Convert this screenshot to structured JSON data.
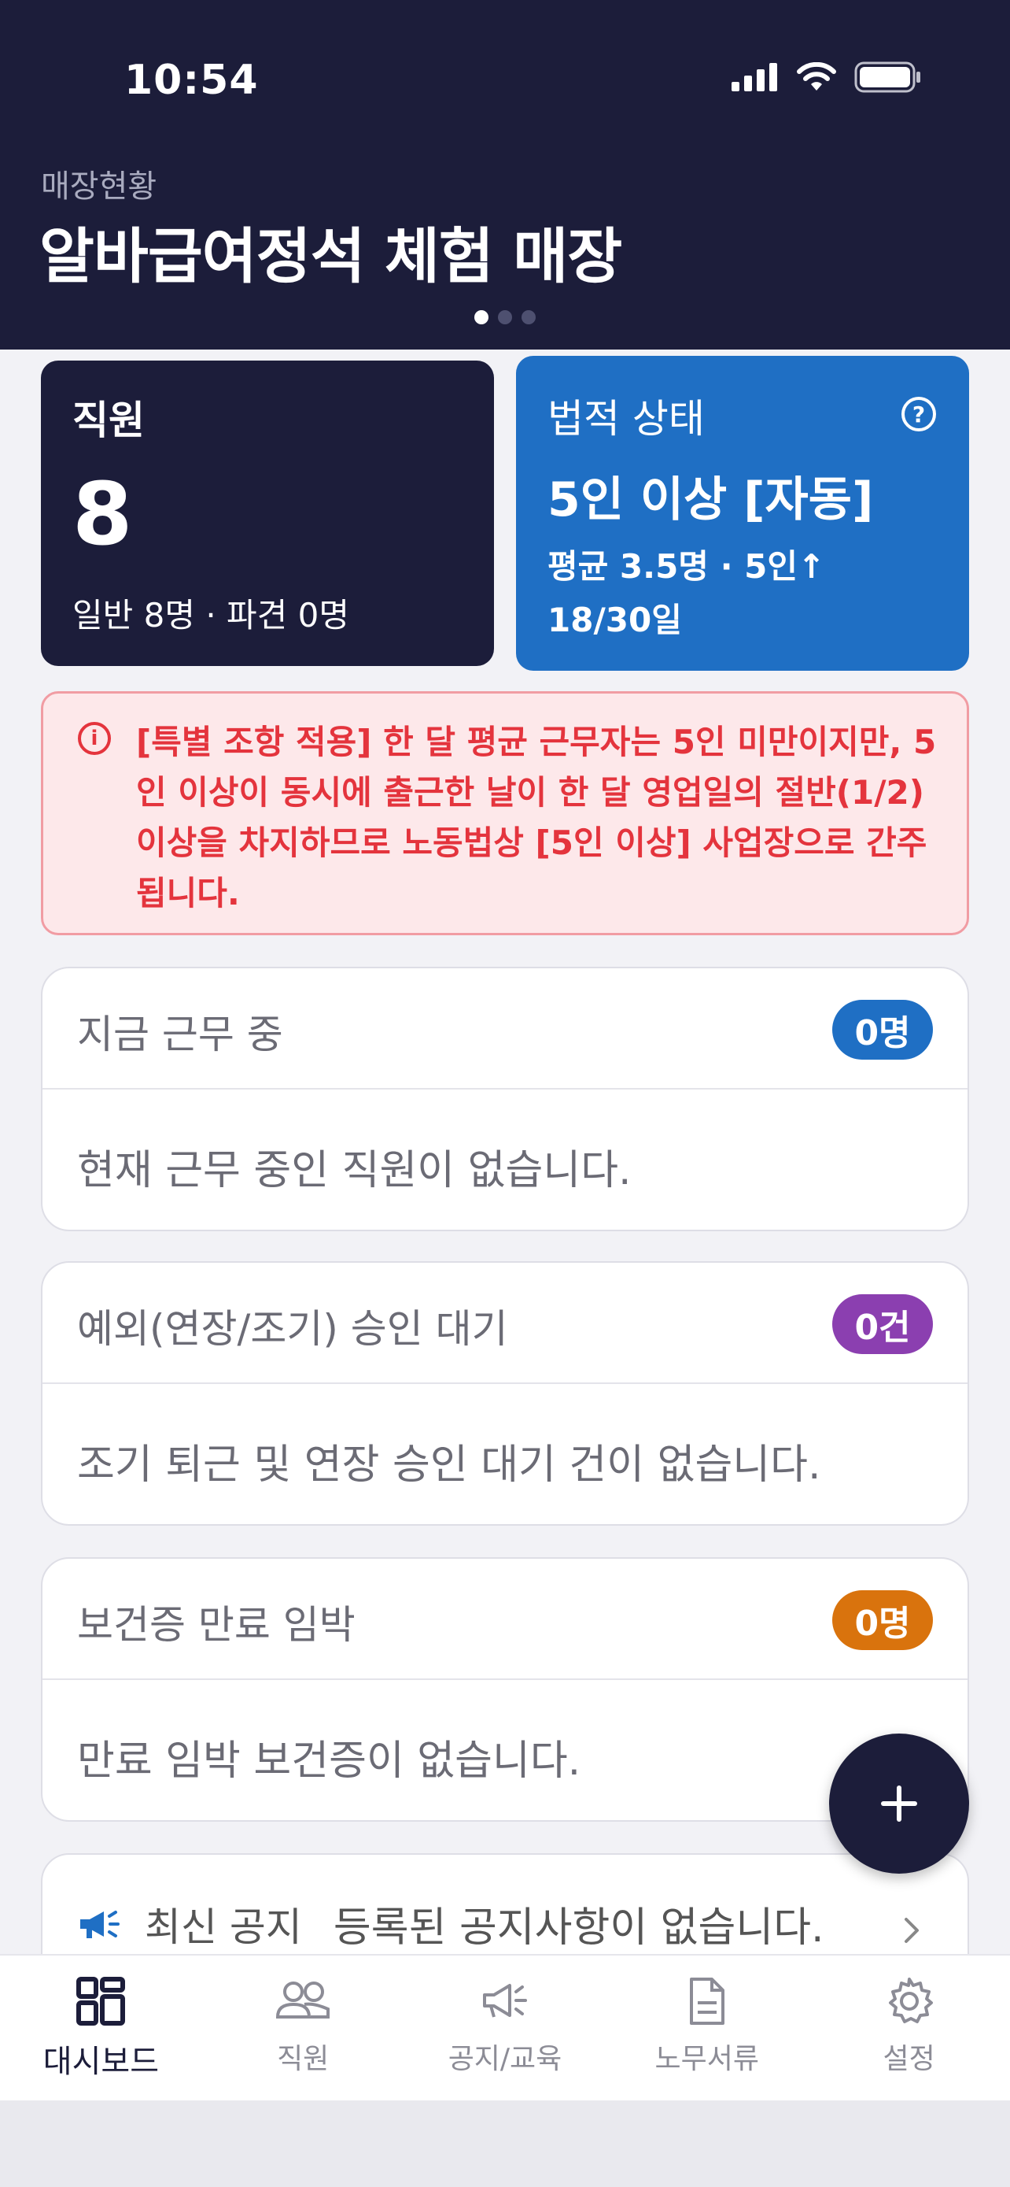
{
  "status_bar": {
    "time": "10:54"
  },
  "header": {
    "subtitle": "매장현황",
    "store_name": "알바급여정석 체험 매장"
  },
  "staff_card": {
    "label": "직원",
    "count": "8",
    "detail": "일반 8명 · 파견 0명"
  },
  "legal_card": {
    "label": "법적 상태",
    "status": "5인 이상 [자동]",
    "average": "평균 3.5명 · 5인↑",
    "days": "18/30일"
  },
  "warning": {
    "text": "[특별 조항 적용] 한 달 평균 근무자는 5인 미만이지만, 5인 이상이 동시에 출근한 날이 한 달 영업일의 절반(1/2) 이상을 차지하므로 노동법상 [5인 이상] 사업장으로 간주됩니다."
  },
  "sections": {
    "working": {
      "title": "지금 근무 중",
      "badge": "0명",
      "empty": "현재 근무 중인 직원이 없습니다.",
      "color": "#1f6fc4"
    },
    "approval": {
      "title": "예외(연장/조기) 승인 대기",
      "badge": "0건",
      "empty": "조기 퇴근 및 연장 승인 대기 건이 없습니다.",
      "color": "#8b3fb0"
    },
    "health": {
      "title": "보건증 만료 임박",
      "badge": "0명",
      "empty": "만료 임박 보건증이 없습니다.",
      "color": "#d9730d"
    }
  },
  "notice": {
    "title": "최신 공지",
    "message": "등록된 공지사항이 없습니다."
  },
  "tabs": [
    {
      "label": "대시보드",
      "icon": "dashboard-icon"
    },
    {
      "label": "직원",
      "icon": "people-icon"
    },
    {
      "label": "공지/교육",
      "icon": "megaphone-icon"
    },
    {
      "label": "노무서류",
      "icon": "document-icon"
    },
    {
      "label": "설정",
      "icon": "gear-icon"
    }
  ]
}
